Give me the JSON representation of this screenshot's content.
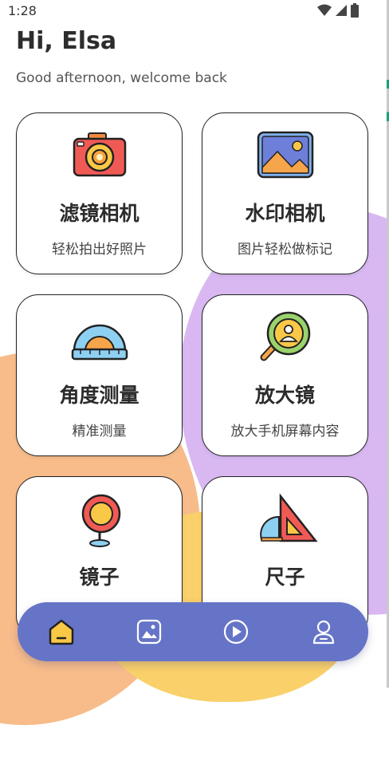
{
  "status": {
    "time": "1:28"
  },
  "header": {
    "greeting": "Hi, Elsa",
    "subtitle": "Good afternoon, welcome back"
  },
  "cards": [
    {
      "title": "滤镜相机",
      "desc": "轻松拍出好照片",
      "icon": "camera-icon"
    },
    {
      "title": "水印相机",
      "desc": "图片轻松做标记",
      "icon": "picture-icon"
    },
    {
      "title": "角度测量",
      "desc": "精准测量",
      "icon": "protractor-icon"
    },
    {
      "title": "放大镜",
      "desc": "放大手机屏幕内容",
      "icon": "magnifier-icon"
    },
    {
      "title": "镜子",
      "desc": "",
      "icon": "mirror-icon"
    },
    {
      "title": "尺子",
      "desc": "",
      "icon": "ruler-icon"
    }
  ],
  "nav": {
    "items": [
      "home-icon",
      "gallery-icon",
      "play-icon",
      "profile-icon"
    ],
    "active": "home-icon"
  },
  "colors": {
    "nav_bg": "#6674c8",
    "accent_yellow": "#f9c846",
    "accent_red": "#f05a55",
    "accent_blue": "#7fc7ee"
  }
}
